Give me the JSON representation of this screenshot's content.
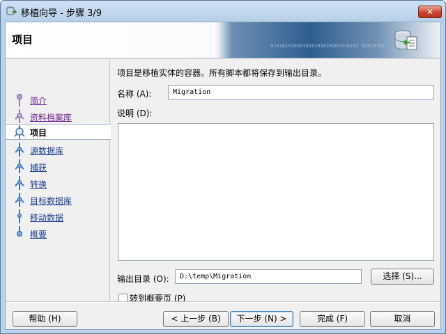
{
  "window": {
    "title": "移植向导 - 步骤 3/9",
    "close_label": "✕"
  },
  "banner": {
    "title": "项目",
    "binary_text": "010101010101010101010101010101 01010101"
  },
  "nav": {
    "items": [
      {
        "label": "简介",
        "state": "visited"
      },
      {
        "label": "资料档案库",
        "state": "visited"
      },
      {
        "label": "项目",
        "state": "active"
      },
      {
        "label": "源数据库",
        "state": "pending"
      },
      {
        "label": "捕获 ",
        "state": "pending"
      },
      {
        "label": "转换",
        "state": "pending"
      },
      {
        "label": "目标数据库",
        "state": "pending"
      },
      {
        "label": "移动数据",
        "state": "pending"
      },
      {
        "label": "概要",
        "state": "pending"
      }
    ]
  },
  "form": {
    "description": "项目是移植实体的容器。所有脚本都将保存到输出目录。",
    "name_label": "名称 (A):",
    "name_value": "Migration",
    "notes_label": "说明 (D):",
    "output_label": "输出目录 (O):",
    "output_value": "D:\\temp\\Migration",
    "choose_label": "选择 (S)...",
    "goto_summary_label": "转到概要页 (P)"
  },
  "footer": {
    "help_label": "帮助 (H)",
    "back_label": "< 上一步 (B)",
    "next_label": "下一步 (N) >",
    "finish_label": "完成 (F)",
    "cancel_label": "取消"
  }
}
